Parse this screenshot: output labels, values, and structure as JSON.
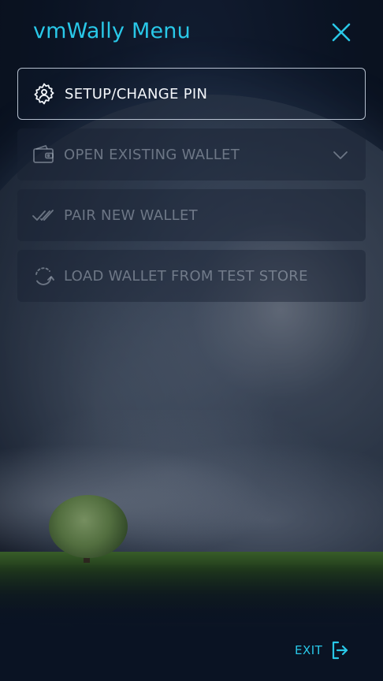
{
  "header": {
    "title": "vmWally Menu",
    "close_icon": "close-icon"
  },
  "menu": {
    "items": [
      {
        "label": "SETUP/CHANGE PIN",
        "icon": "settings-user-icon",
        "active": true
      },
      {
        "label": "OPEN EXISTING WALLET",
        "icon": "wallet-icon",
        "active": false,
        "has_dropdown": true
      },
      {
        "label": "PAIR NEW WALLET",
        "icon": "double-check-icon",
        "active": false
      },
      {
        "label": "LOAD WALLET FROM TEST STORE",
        "icon": "refresh-icon",
        "active": false
      }
    ]
  },
  "footer": {
    "exit_label": "EXIT",
    "exit_icon": "exit-icon"
  },
  "colors": {
    "accent": "#29c8e8",
    "active_text": "#f4f7fb",
    "disabled_text": "#aab2c0"
  }
}
